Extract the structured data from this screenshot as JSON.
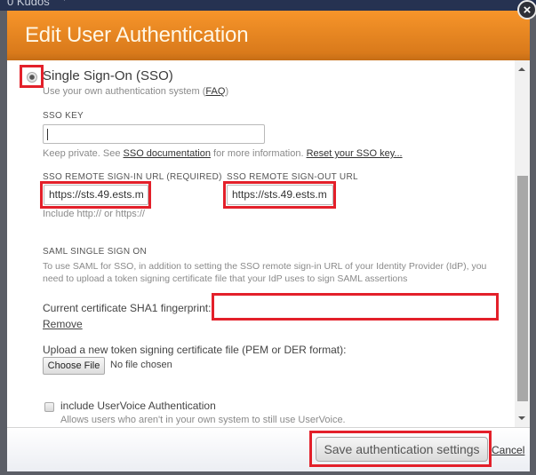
{
  "background": {
    "app_label": "0  Kudos",
    "chevron": "▾"
  },
  "dialog": {
    "title": "Edit User Authentication",
    "close_icon": "×"
  },
  "sso": {
    "option_label": "Single Sign-On (SSO)",
    "selected": true,
    "description_prefix": "Use your own authentication system (",
    "faq_link": "FAQ",
    "description_suffix": ")",
    "sso_key": {
      "label": "SSO KEY",
      "value": "",
      "help_prefix": "Keep private. See ",
      "doc_link": "SSO documentation",
      "help_middle": " for more information. ",
      "reset_link": "Reset your SSO key..."
    },
    "sign_in_url": {
      "label": "SSO REMOTE SIGN-IN URL (REQUIRED)",
      "value": "https://sts.49.ests.m",
      "help": "Include http:// or https://"
    },
    "sign_out_url": {
      "label": "SSO REMOTE SIGN-OUT URL",
      "value": "https://sts.49.ests.m"
    }
  },
  "saml": {
    "heading": "SAML SINGLE SIGN ON",
    "description_line1": "To use SAML for SSO, in addition to setting the SSO remote sign-in URL of your Identity Provider (IdP), you",
    "description_line2": "need to upload a token signing certificate file that your IdP uses to sign SAML assertions",
    "fingerprint_label": "Current certificate SHA1 fingerprint:",
    "fingerprint_value": "",
    "remove_link": "Remove",
    "upload_label": "Upload a new token signing certificate file (PEM or DER format):",
    "choose_file_label": "Choose File",
    "file_status": "No file chosen"
  },
  "uservoice": {
    "checkbox_label": "include UserVoice Authentication",
    "checked": false,
    "description": "Allows users who aren't in your own system to still use UserVoice."
  },
  "footer": {
    "save_label": "Save authentication settings",
    "cancel_label": "Cancel"
  },
  "colors": {
    "header_orange": "#f7952a",
    "highlight_red": "#e3202a"
  }
}
